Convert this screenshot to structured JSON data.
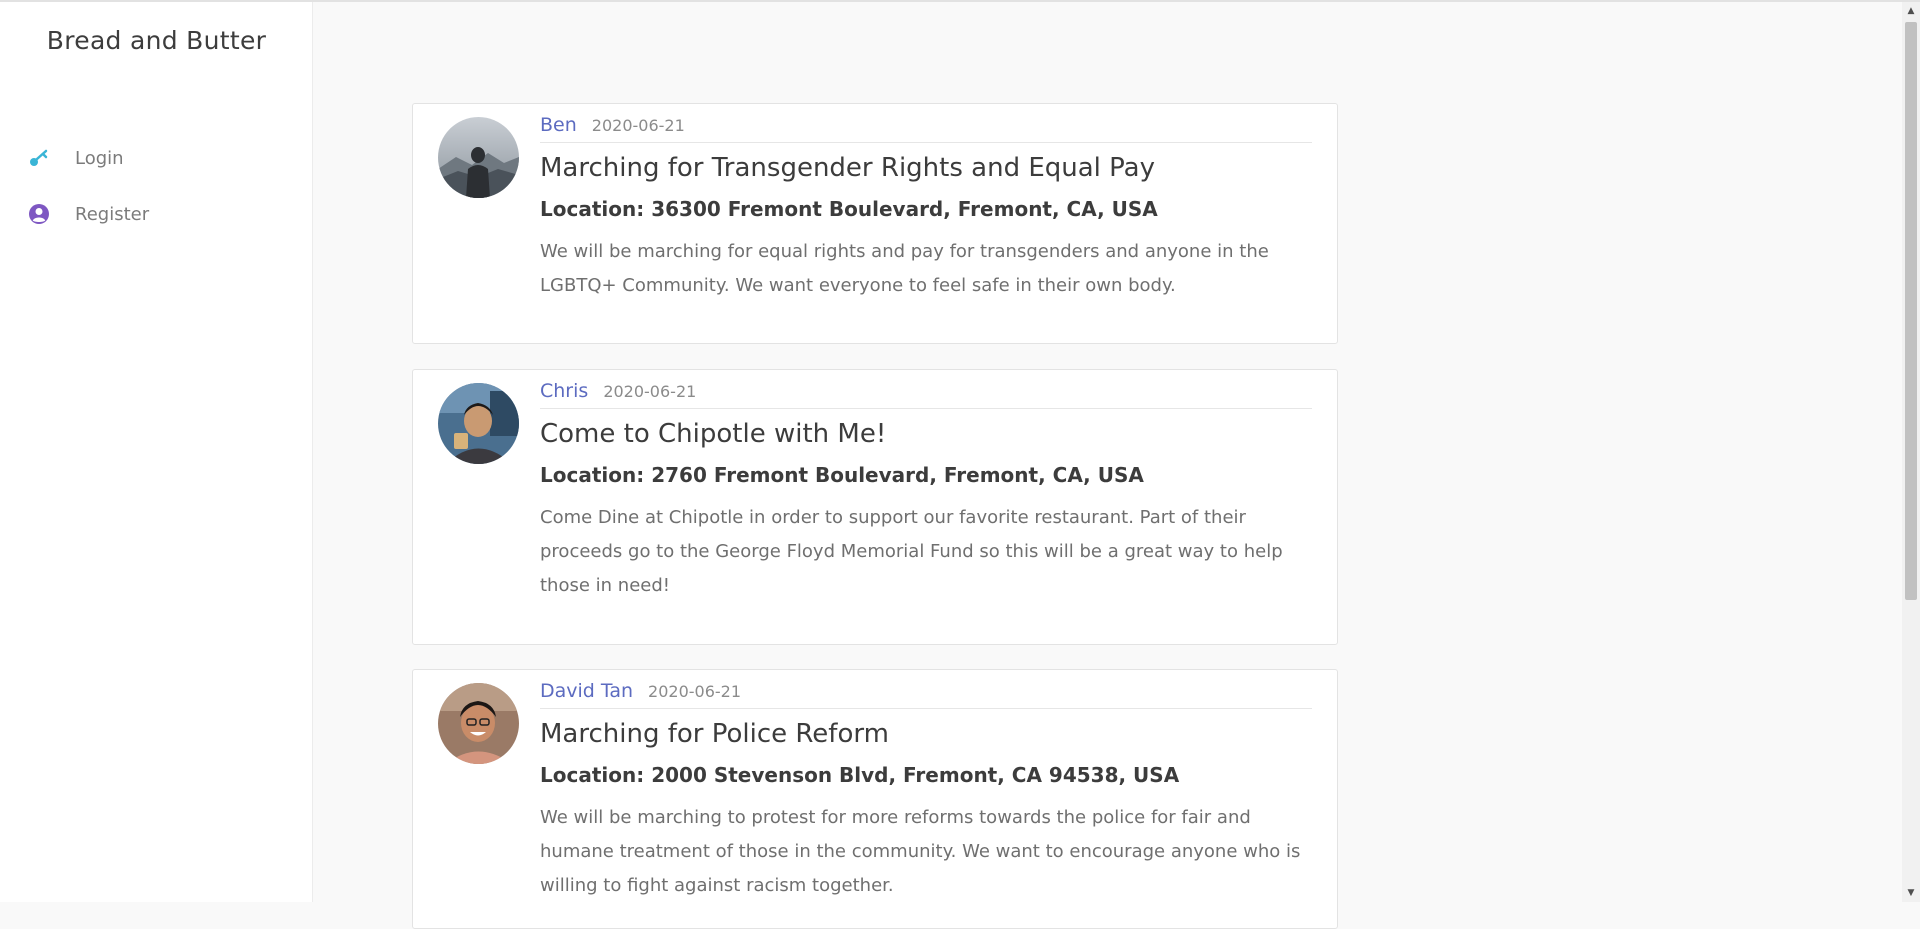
{
  "app": {
    "title": "Bread and Butter"
  },
  "sidebar": {
    "items": [
      {
        "label": "Login",
        "icon": "key-icon",
        "color": "#3ab5d6"
      },
      {
        "label": "Register",
        "icon": "user-circle-icon",
        "color": "#7e57c2"
      }
    ]
  },
  "posts": [
    {
      "author": "Ben",
      "date": "2020-06-21",
      "title": "Marching for Transgender Rights and Equal Pay",
      "location": "Location: 36300 Fremont Boulevard, Fremont, CA, USA",
      "description": "We will be marching for equal rights and pay for transgenders and anyone in the LGBTQ+ Community. We want everyone to feel safe in their own body."
    },
    {
      "author": "Chris",
      "date": "2020-06-21",
      "title": "Come to Chipotle with Me!",
      "location": "Location: 2760 Fremont Boulevard, Fremont, CA, USA",
      "description": "Come Dine at Chipotle in order to support our favorite restaurant. Part of their proceeds go to the George Floyd Memorial Fund so this will be a great way to help those in need!"
    },
    {
      "author": "David Tan",
      "date": "2020-06-21",
      "title": "Marching for Police Reform",
      "location": "Location: 2000 Stevenson Blvd, Fremont, CA 94538, USA",
      "description": "We will be marching to protest for more reforms towards the police for fair and humane treatment of those in the community. We want to encourage anyone who is willing to fight against racism together."
    }
  ],
  "colors": {
    "accent": "#5c6bc0",
    "text_dark": "#3c3c3c",
    "text_muted": "#6f6f6f"
  }
}
